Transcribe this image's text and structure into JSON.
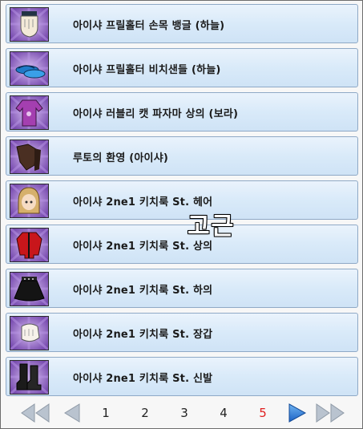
{
  "items": [
    {
      "name": "아이샤 프릴홀터 손목 뱅글 (하늘)",
      "icon": "wrist-bangle-icon"
    },
    {
      "name": "아이샤 프릴홀터 비치샌들 (하늘)",
      "icon": "beach-sandals-icon"
    },
    {
      "name": "아이샤 러블리 캣 파자마 상의 (보라)",
      "icon": "pajama-top-icon"
    },
    {
      "name": "루토의 환영 (아이샤)",
      "icon": "ruto-phantom-icon"
    },
    {
      "name": "아이샤 2ne1 키치룩 St. 헤어",
      "icon": "hair-icon"
    },
    {
      "name": "아이샤 2ne1 키치룩 St. 상의",
      "icon": "top-icon"
    },
    {
      "name": "아이샤 2ne1 키치룩 St. 하의",
      "icon": "skirt-icon"
    },
    {
      "name": "아이샤 2ne1 키치룩 St. 장갑",
      "icon": "glove-icon"
    },
    {
      "name": "아이샤 2ne1 키치룩 St. 신발",
      "icon": "boots-icon"
    }
  ],
  "watermark": "고근",
  "pager": {
    "pages": [
      "1",
      "2",
      "3",
      "4",
      "5"
    ],
    "current": "5",
    "first_icon": "double-left-arrow-icon",
    "prev_icon": "left-arrow-icon",
    "next_icon": "right-arrow-icon",
    "last_icon": "double-right-arrow-icon"
  },
  "colors": {
    "row_border": "#8fa9c6",
    "thumb_purple": "#8a5cc0",
    "active_page": "#e02020",
    "next_arrow": "#2a7ad8"
  }
}
